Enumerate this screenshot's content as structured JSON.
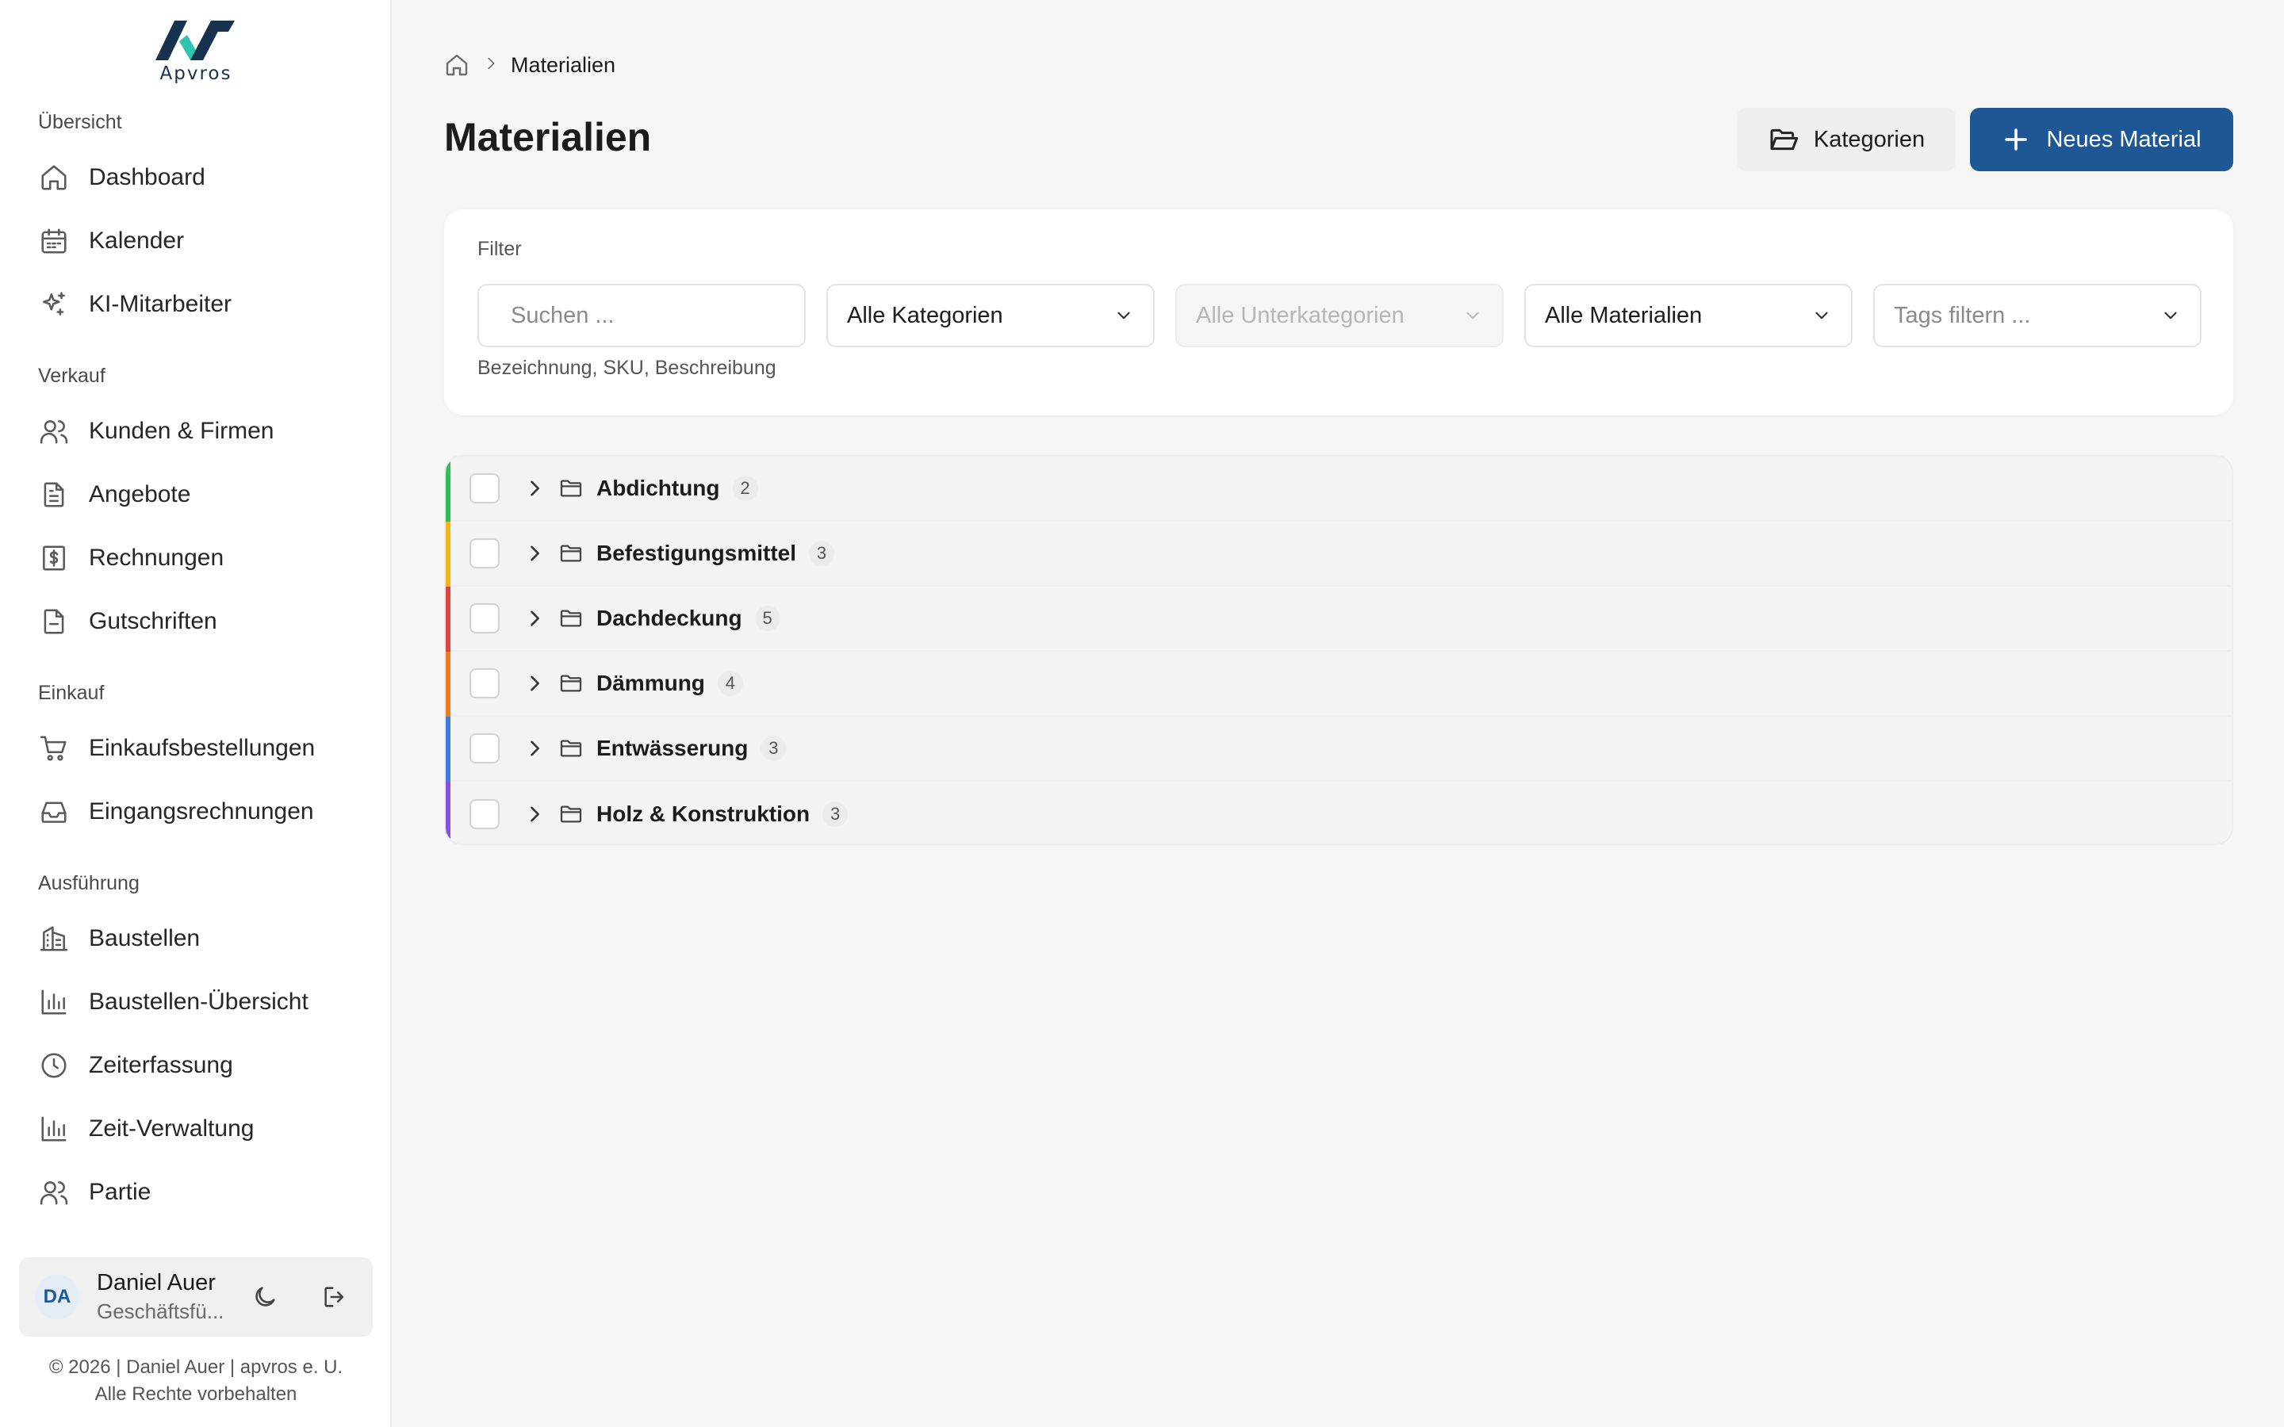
{
  "app": {
    "logo_text": "Apvros",
    "brand_dark": "#16324f",
    "brand_accent": "#2fc4b2",
    "primary_color": "#1d5796"
  },
  "sidebar": {
    "sections": [
      {
        "label": "Übersicht"
      },
      {
        "label": "Verkauf"
      },
      {
        "label": "Einkauf"
      },
      {
        "label": "Ausführung"
      }
    ],
    "items": [
      {
        "label": "Dashboard",
        "icon": "home-icon"
      },
      {
        "label": "Kalender",
        "icon": "calendar-icon"
      },
      {
        "label": "KI-Mitarbeiter",
        "icon": "sparkles-icon"
      },
      {
        "label": "Kunden & Firmen",
        "icon": "users-icon"
      },
      {
        "label": "Angebote",
        "icon": "file-text-icon"
      },
      {
        "label": "Rechnungen",
        "icon": "invoice-dollar-icon"
      },
      {
        "label": "Gutschriften",
        "icon": "file-icon"
      },
      {
        "label": "Einkaufsbestellungen",
        "icon": "shopping-cart-icon"
      },
      {
        "label": "Eingangsrechnungen",
        "icon": "inbox-icon"
      },
      {
        "label": "Baustellen",
        "icon": "building-icon"
      },
      {
        "label": "Baustellen-Übersicht",
        "icon": "bar-chart-icon"
      },
      {
        "label": "Zeiterfassung",
        "icon": "clock-icon"
      },
      {
        "label": "Zeit-Verwaltung",
        "icon": "bar-chart-icon"
      },
      {
        "label": "Partie",
        "icon": "users-icon"
      }
    ],
    "user": {
      "initials": "DA",
      "name": "Daniel Auer",
      "role": "Geschäftsfü..."
    },
    "footer_line1": "© 2026 | Daniel Auer | apvros e. U.",
    "footer_line2": "Alle Rechte vorbehalten"
  },
  "breadcrumb": {
    "current": "Materialien"
  },
  "page": {
    "title": "Materialien",
    "categories_button": "Kategorien",
    "new_button": "Neues Material"
  },
  "filter": {
    "label": "Filter",
    "search_placeholder": "Suchen ...",
    "search_hint": "Bezeichnung, SKU, Beschreibung",
    "category_select": "Alle Kategorien",
    "subcategory_select": "Alle Unterkategorien",
    "material_select": "Alle Materialien",
    "tags_select": "Tags filtern ..."
  },
  "categories": [
    {
      "name": "Abdichtung",
      "count": "2",
      "color": "#2fbf5a"
    },
    {
      "name": "Befestigungsmittel",
      "count": "3",
      "color": "#f2b418"
    },
    {
      "name": "Dachdeckung",
      "count": "5",
      "color": "#e0443b"
    },
    {
      "name": "Dämmung",
      "count": "4",
      "color": "#f07a1f"
    },
    {
      "name": "Entwässerung",
      "count": "3",
      "color": "#3d7be0"
    },
    {
      "name": "Holz & Konstruktion",
      "count": "3",
      "color": "#8b4fe0"
    }
  ]
}
